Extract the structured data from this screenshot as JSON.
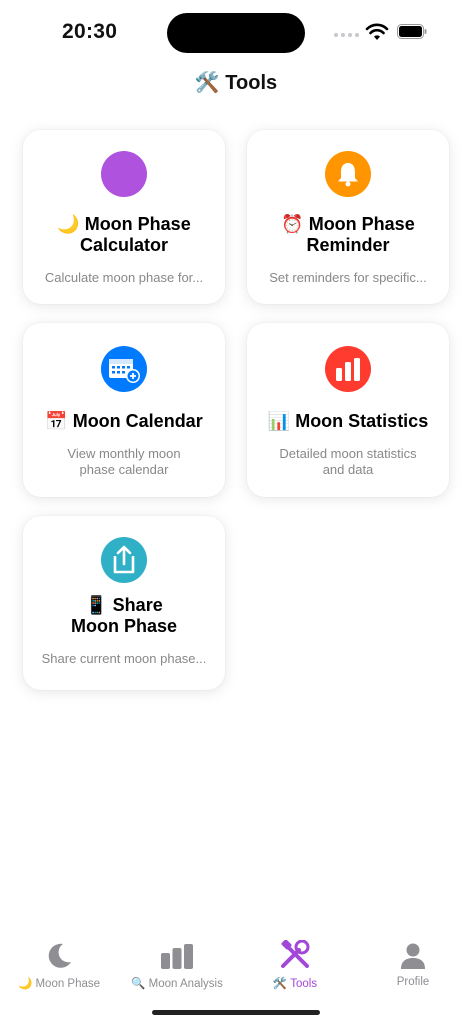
{
  "status": {
    "time": "20:30"
  },
  "header": {
    "title": "🛠️ Tools"
  },
  "cards": [
    {
      "icon": "purple-circle-icon",
      "color": "#af52de",
      "title_line1": "🌙 Moon Phase",
      "title_line2": "Calculator",
      "desc_line1": "Calculate moon phase for...",
      "desc_line2": ""
    },
    {
      "icon": "bell-icon",
      "color": "#ff9500",
      "title_line1": "⏰ Moon Phase",
      "title_line2": "Reminder",
      "desc_line1": "Set reminders for specific...",
      "desc_line2": ""
    },
    {
      "icon": "calendar-add-icon",
      "color": "#007aff",
      "title_line1": "📅 Moon Calendar",
      "title_line2": "",
      "desc_line1": "View monthly moon",
      "desc_line2": "phase calendar"
    },
    {
      "icon": "bar-chart-icon",
      "color": "#ff3b30",
      "title_line1": "📊 Moon Statistics",
      "title_line2": "",
      "desc_line1": "Detailed moon statistics",
      "desc_line2": "and data"
    },
    {
      "icon": "share-icon",
      "color": "#30b0c7",
      "title_line1": "📱 Share",
      "title_line2": "Moon Phase",
      "desc_line1": "Share current moon phase...",
      "desc_line2": ""
    }
  ],
  "tabs": [
    {
      "label": "🌙 Moon Phase",
      "icon": "moon-icon",
      "active": false
    },
    {
      "label": "🔍 Moon Analysis",
      "icon": "chart-icon",
      "active": false
    },
    {
      "label": "🛠️ Tools",
      "icon": "tools-icon",
      "active": true
    },
    {
      "label": "Profile",
      "icon": "person-icon",
      "active": false
    }
  ],
  "colors": {
    "accent": "#a347d9",
    "inactive": "#8e8e93"
  }
}
